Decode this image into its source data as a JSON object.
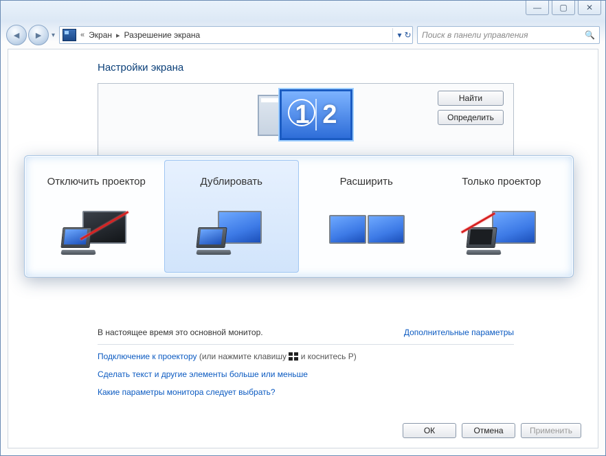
{
  "window_controls": {
    "min": "—",
    "max": "▢",
    "close": "✕"
  },
  "nav": {
    "back_glyph": "◄",
    "fwd_glyph": "►",
    "dropdown_glyph": "▾",
    "refresh_glyph": "↻"
  },
  "breadcrumb": {
    "prefix": "«",
    "item1": "Экран",
    "sep": "▸",
    "item2": "Разрешение экрана"
  },
  "search": {
    "placeholder": "Поиск в панели управления",
    "mag": "🔍"
  },
  "page": {
    "title": "Настройки экрана",
    "find_btn": "Найти",
    "identify_btn": "Определить",
    "status_text": "В настоящее время это основной монитор.",
    "advanced_link": "Дополнительные параметры",
    "connect_link": "Подключение к проектору",
    "connect_hint_a": " (или нажмите клавишу ",
    "connect_hint_b": " и коснитесь P)",
    "resize_link": "Сделать текст и другие элементы больше или меньше",
    "which_link": "Какие параметры монитора следует выбрать?",
    "monitor_num1": "1",
    "monitor_num2": "2"
  },
  "popup": {
    "options": [
      {
        "key": "disconnect",
        "label": "Отключить проектор",
        "selected": false
      },
      {
        "key": "duplicate",
        "label": "Дублировать",
        "selected": true
      },
      {
        "key": "extend",
        "label": "Расширить",
        "selected": false
      },
      {
        "key": "projector",
        "label": "Только проектор",
        "selected": false
      }
    ]
  },
  "footer": {
    "ok": "ОК",
    "cancel": "Отмена",
    "apply": "Применить"
  }
}
